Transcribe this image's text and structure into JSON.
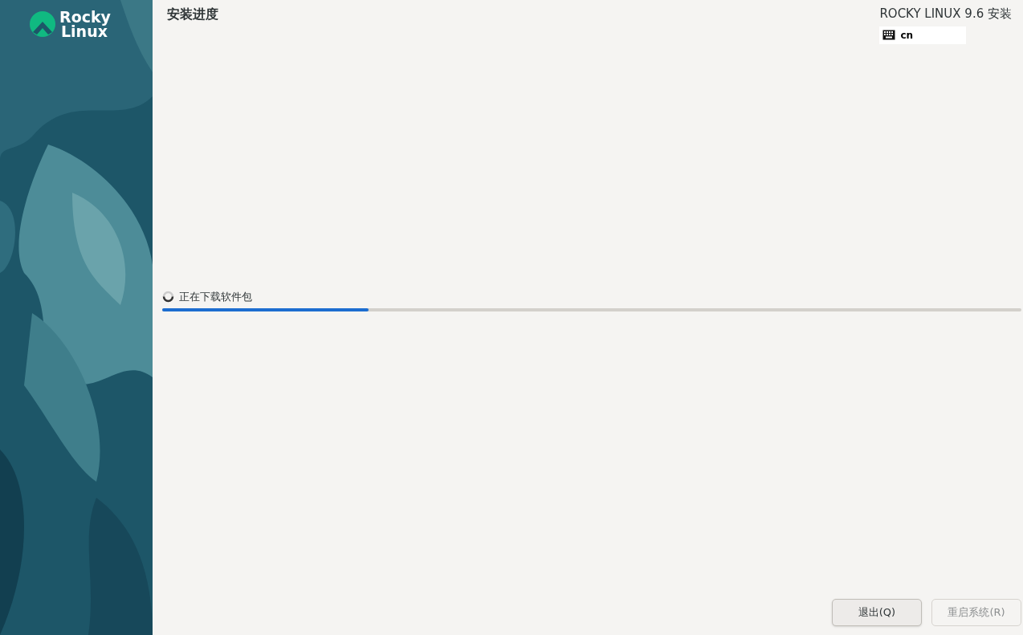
{
  "sidebar": {
    "logo": {
      "line1": "Rocky",
      "line2": "Linux"
    }
  },
  "header": {
    "title": "安装进度",
    "product": "ROCKY LINUX 9.6 安装",
    "keyboard_layout": "cn"
  },
  "progress": {
    "status": "正在下载软件包",
    "level": 0.24
  },
  "buttons": [
    {
      "label": "退出(Q)",
      "disabled": false
    },
    {
      "label": "重启系统(R)",
      "disabled": true
    }
  ]
}
